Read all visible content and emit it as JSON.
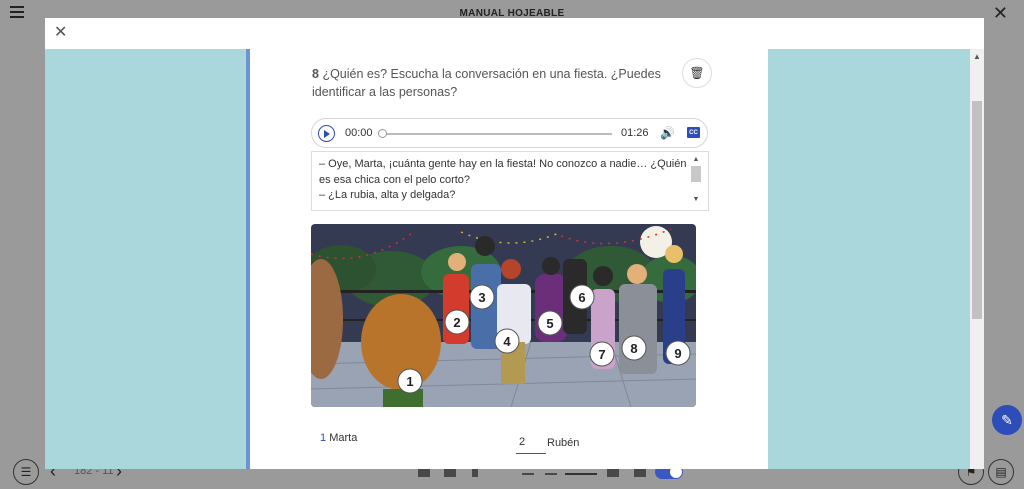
{
  "app": {
    "title": "MANUAL HOJEABLE"
  },
  "bottom": {
    "page_indicator": "182 - 11"
  },
  "exercise": {
    "number": "8",
    "prompt": "¿Quién es? Escucha la conversación en una fiesta. ¿Puedes identificar a las personas?"
  },
  "audio": {
    "current": "00:00",
    "total": "01:26",
    "progress": 0,
    "cc_label": "CC"
  },
  "transcript": {
    "lines": [
      "– Oye, Marta, ¡cuánta gente hay en la fiesta! No conozco a nadie… ¿Quién es esa chica con el pelo corto?",
      "– ¿La rubia, alta y delgada?"
    ]
  },
  "illustration": {
    "numbers": [
      "1",
      "2",
      "3",
      "4",
      "5",
      "6",
      "7",
      "8",
      "9"
    ]
  },
  "answers": [
    {
      "number": "1",
      "name": "Marta",
      "value": ""
    },
    {
      "number": "",
      "name": "Rubén",
      "value": "2"
    }
  ],
  "colors": {
    "accent": "#2d4db8",
    "viewer_bg": "#a9d7dc",
    "page_rule": "#6b93d6"
  }
}
